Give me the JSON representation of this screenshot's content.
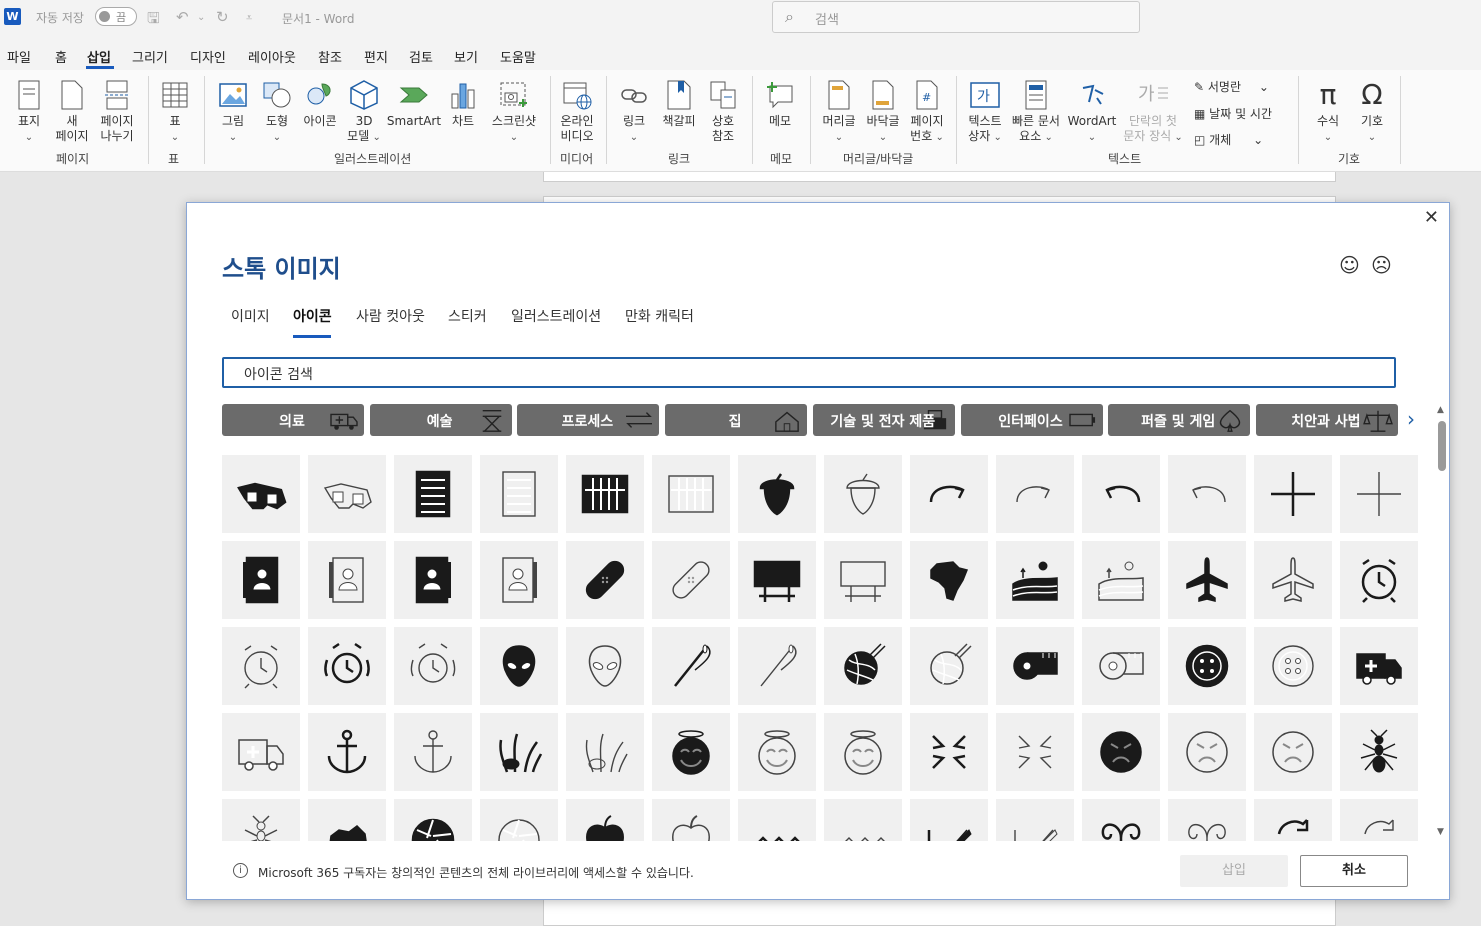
{
  "titlebar": {
    "autosave_label": "자동 저장",
    "autosave_state": "끔",
    "doc_title": "문서1  -  Word",
    "search_placeholder": "검색"
  },
  "menu": [
    "파일",
    "홈",
    "삽입",
    "그리기",
    "디자인",
    "레이아웃",
    "참조",
    "편지",
    "검토",
    "보기",
    "도움말"
  ],
  "ribbon": {
    "pages": {
      "cover": "표지",
      "new_page_1": "새",
      "new_page_2": "페이지",
      "break_1": "페이지",
      "break_2": "나누기",
      "group": "페이지"
    },
    "table": {
      "table": "표",
      "group": "표"
    },
    "illustrations": {
      "pictures": "그림",
      "shapes": "도형",
      "icons": "아이콘",
      "model_1": "3D",
      "model_2": "모델",
      "smartart": "SmartArt",
      "chart": "차트",
      "screenshot": "스크린샷",
      "group": "일러스트레이션"
    },
    "media": {
      "online_1": "온라인",
      "online_2": "비디오",
      "group": "미디어"
    },
    "links": {
      "link": "링크",
      "bookmark": "책갈피",
      "xref_1": "상호",
      "xref_2": "참조",
      "group": "링크"
    },
    "comments": {
      "comment": "메모",
      "group": "메모"
    },
    "header_footer": {
      "header": "머리글",
      "footer": "바닥글",
      "pagenum_1": "페이지",
      "pagenum_2": "번호",
      "group": "머리글/바닥글"
    },
    "text": {
      "textbox_1": "텍스트",
      "textbox_2": "상자",
      "quickparts_1": "빠른 문서",
      "quickparts_2": "요소",
      "wordart": "WordArt",
      "dropcap_1": "단락의 첫",
      "dropcap_2": "문자 장식",
      "signature": "서명란",
      "datetime": "날짜 및 시간",
      "object": "개체",
      "group": "텍스트"
    },
    "symbols": {
      "equation": "수식",
      "symbol": "기호",
      "group": "기호"
    }
  },
  "dialog": {
    "title": "스톡 이미지",
    "tabs": [
      "이미지",
      "아이콘",
      "사람 컷아웃",
      "스티커",
      "일러스트레이션",
      "만화 캐릭터"
    ],
    "active_tab": "아이콘",
    "search_placeholder": "아이콘 검색",
    "categories": [
      {
        "label": "의료",
        "icon": "ambulance-icon"
      },
      {
        "label": "예술",
        "icon": "directors-chair-icon"
      },
      {
        "label": "프로세스",
        "icon": "arrows-icon"
      },
      {
        "label": "집",
        "icon": "house-icon"
      },
      {
        "label": "기술 및 전자 제품",
        "icon": "typewriter-icon"
      },
      {
        "label": "인터페이스",
        "icon": "battery-icon"
      },
      {
        "label": "퍼즐 및 게임",
        "icon": "spade-icon"
      },
      {
        "label": "치안과 사법",
        "icon": "scales-icon"
      }
    ],
    "icon_rows": [
      [
        "3d-glasses-filled",
        "3d-glasses-outline",
        "abacus-filled",
        "abacus-outline",
        "abacus-wide-filled",
        "abacus-wide-outline",
        "acorn-filled",
        "acorn-outline",
        "curved-arrow-right-filled",
        "curved-arrow-right-outline",
        "curved-arrow-left-filled",
        "curved-arrow-left-outline",
        "add-filled",
        "add-outline"
      ],
      [
        "address-book-filled",
        "address-book-outline",
        "contact-book-filled",
        "contact-book-outline",
        "bandage-filled",
        "bandage-outline",
        "billboard-filled",
        "billboard-outline",
        "africa-filled",
        "farm-filled",
        "farm-outline",
        "airplane-filled",
        "airplane-outline",
        "alarm-clock-filled"
      ],
      [
        "alarm-clock-outline",
        "alarm-ringing-filled",
        "alarm-ringing-outline",
        "alien-filled",
        "alien-outline",
        "needle-filled",
        "needle-outline",
        "yarn-filled",
        "yarn-outline",
        "tape-measure-filled",
        "tape-measure-outline",
        "button-filled",
        "button-outline",
        "ambulance-filled"
      ],
      [
        "ambulance-outline",
        "anchor-filled",
        "anchor-outline",
        "reef-filled",
        "reef-outline",
        "angel-face-filled",
        "angel-face-outline",
        "angel-face-outline-2",
        "anger-symbol-filled",
        "anger-symbol-outline",
        "angry-face-filled",
        "angry-face-outline",
        "angry-face-outline-2",
        "ant-filled"
      ],
      [
        "ant-outline",
        "antarctica-filled",
        "aperture-filled",
        "aperture-outline",
        "apple-filled",
        "apple-outline",
        "zigzag-filled",
        "zigzag-outline",
        "graph-pencil-filled",
        "graph-pencil-outline",
        "aries-filled",
        "aries-outline",
        "refresh-filled",
        "refresh-outline"
      ]
    ],
    "footer_info": "Microsoft 365 구독자는 창의적인 콘텐츠의 전체 라이브러리에 액세스할 수 있습니다.",
    "insert_label": "삽입",
    "cancel_label": "취소"
  }
}
